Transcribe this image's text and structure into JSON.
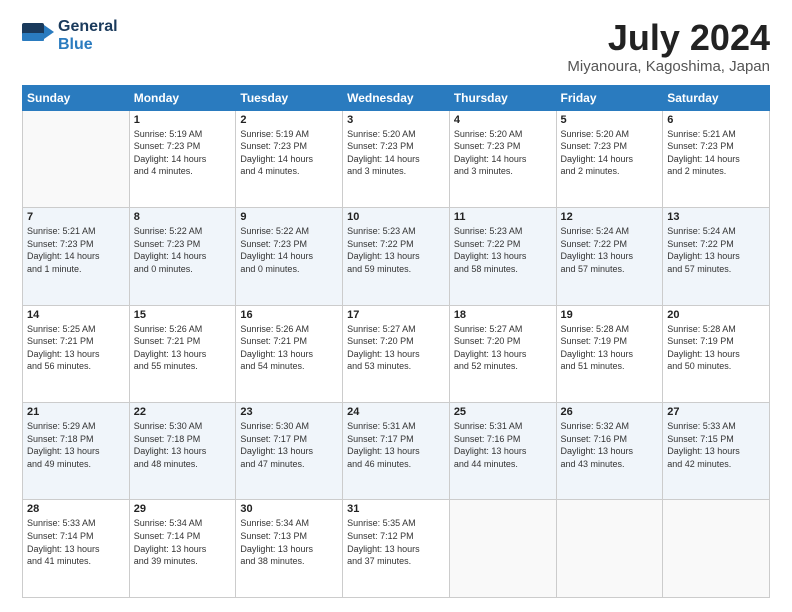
{
  "logo": {
    "line1": "General",
    "line2": "Blue"
  },
  "title": "July 2024",
  "location": "Miyanoura, Kagoshima, Japan",
  "days_of_week": [
    "Sunday",
    "Monday",
    "Tuesday",
    "Wednesday",
    "Thursday",
    "Friday",
    "Saturday"
  ],
  "weeks": [
    [
      {
        "day": "",
        "content": ""
      },
      {
        "day": "1",
        "content": "Sunrise: 5:19 AM\nSunset: 7:23 PM\nDaylight: 14 hours\nand 4 minutes."
      },
      {
        "day": "2",
        "content": "Sunrise: 5:19 AM\nSunset: 7:23 PM\nDaylight: 14 hours\nand 4 minutes."
      },
      {
        "day": "3",
        "content": "Sunrise: 5:20 AM\nSunset: 7:23 PM\nDaylight: 14 hours\nand 3 minutes."
      },
      {
        "day": "4",
        "content": "Sunrise: 5:20 AM\nSunset: 7:23 PM\nDaylight: 14 hours\nand 3 minutes."
      },
      {
        "day": "5",
        "content": "Sunrise: 5:20 AM\nSunset: 7:23 PM\nDaylight: 14 hours\nand 2 minutes."
      },
      {
        "day": "6",
        "content": "Sunrise: 5:21 AM\nSunset: 7:23 PM\nDaylight: 14 hours\nand 2 minutes."
      }
    ],
    [
      {
        "day": "7",
        "content": "Sunrise: 5:21 AM\nSunset: 7:23 PM\nDaylight: 14 hours\nand 1 minute."
      },
      {
        "day": "8",
        "content": "Sunrise: 5:22 AM\nSunset: 7:23 PM\nDaylight: 14 hours\nand 0 minutes."
      },
      {
        "day": "9",
        "content": "Sunrise: 5:22 AM\nSunset: 7:23 PM\nDaylight: 14 hours\nand 0 minutes."
      },
      {
        "day": "10",
        "content": "Sunrise: 5:23 AM\nSunset: 7:22 PM\nDaylight: 13 hours\nand 59 minutes."
      },
      {
        "day": "11",
        "content": "Sunrise: 5:23 AM\nSunset: 7:22 PM\nDaylight: 13 hours\nand 58 minutes."
      },
      {
        "day": "12",
        "content": "Sunrise: 5:24 AM\nSunset: 7:22 PM\nDaylight: 13 hours\nand 57 minutes."
      },
      {
        "day": "13",
        "content": "Sunrise: 5:24 AM\nSunset: 7:22 PM\nDaylight: 13 hours\nand 57 minutes."
      }
    ],
    [
      {
        "day": "14",
        "content": "Sunrise: 5:25 AM\nSunset: 7:21 PM\nDaylight: 13 hours\nand 56 minutes."
      },
      {
        "day": "15",
        "content": "Sunrise: 5:26 AM\nSunset: 7:21 PM\nDaylight: 13 hours\nand 55 minutes."
      },
      {
        "day": "16",
        "content": "Sunrise: 5:26 AM\nSunset: 7:21 PM\nDaylight: 13 hours\nand 54 minutes."
      },
      {
        "day": "17",
        "content": "Sunrise: 5:27 AM\nSunset: 7:20 PM\nDaylight: 13 hours\nand 53 minutes."
      },
      {
        "day": "18",
        "content": "Sunrise: 5:27 AM\nSunset: 7:20 PM\nDaylight: 13 hours\nand 52 minutes."
      },
      {
        "day": "19",
        "content": "Sunrise: 5:28 AM\nSunset: 7:19 PM\nDaylight: 13 hours\nand 51 minutes."
      },
      {
        "day": "20",
        "content": "Sunrise: 5:28 AM\nSunset: 7:19 PM\nDaylight: 13 hours\nand 50 minutes."
      }
    ],
    [
      {
        "day": "21",
        "content": "Sunrise: 5:29 AM\nSunset: 7:18 PM\nDaylight: 13 hours\nand 49 minutes."
      },
      {
        "day": "22",
        "content": "Sunrise: 5:30 AM\nSunset: 7:18 PM\nDaylight: 13 hours\nand 48 minutes."
      },
      {
        "day": "23",
        "content": "Sunrise: 5:30 AM\nSunset: 7:17 PM\nDaylight: 13 hours\nand 47 minutes."
      },
      {
        "day": "24",
        "content": "Sunrise: 5:31 AM\nSunset: 7:17 PM\nDaylight: 13 hours\nand 46 minutes."
      },
      {
        "day": "25",
        "content": "Sunrise: 5:31 AM\nSunset: 7:16 PM\nDaylight: 13 hours\nand 44 minutes."
      },
      {
        "day": "26",
        "content": "Sunrise: 5:32 AM\nSunset: 7:16 PM\nDaylight: 13 hours\nand 43 minutes."
      },
      {
        "day": "27",
        "content": "Sunrise: 5:33 AM\nSunset: 7:15 PM\nDaylight: 13 hours\nand 42 minutes."
      }
    ],
    [
      {
        "day": "28",
        "content": "Sunrise: 5:33 AM\nSunset: 7:14 PM\nDaylight: 13 hours\nand 41 minutes."
      },
      {
        "day": "29",
        "content": "Sunrise: 5:34 AM\nSunset: 7:14 PM\nDaylight: 13 hours\nand 39 minutes."
      },
      {
        "day": "30",
        "content": "Sunrise: 5:34 AM\nSunset: 7:13 PM\nDaylight: 13 hours\nand 38 minutes."
      },
      {
        "day": "31",
        "content": "Sunrise: 5:35 AM\nSunset: 7:12 PM\nDaylight: 13 hours\nand 37 minutes."
      },
      {
        "day": "",
        "content": ""
      },
      {
        "day": "",
        "content": ""
      },
      {
        "day": "",
        "content": ""
      }
    ]
  ]
}
